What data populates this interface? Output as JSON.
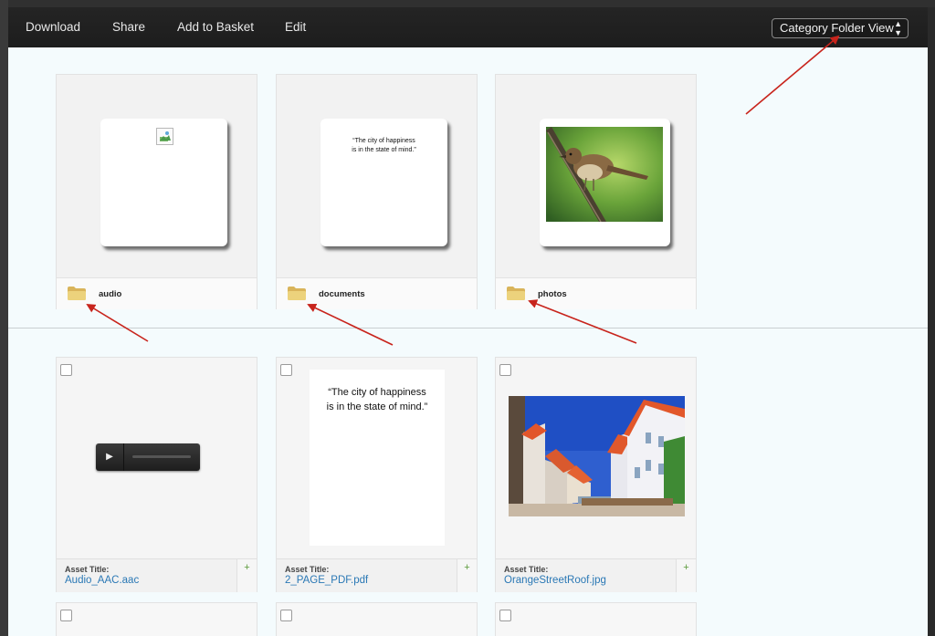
{
  "toolbar": {
    "download_label": "Download",
    "share_label": "Share",
    "add_to_basket_label": "Add to Basket",
    "edit_label": "Edit",
    "view_select_value": "Category Folder View"
  },
  "folders": [
    {
      "label": "audio"
    },
    {
      "label": "documents",
      "preview_quote_line1": "“The city of happiness",
      "preview_quote_line2": "is in the state of mind.”"
    },
    {
      "label": "photos"
    }
  ],
  "assets": [
    {
      "title_label": "Asset Title:",
      "filename": "Audio_AAC.aac",
      "add_label": "+"
    },
    {
      "title_label": "Asset Title:",
      "filename": "2_PAGE_PDF.pdf",
      "add_label": "+",
      "quote_line1": "“The city of happiness",
      "quote_line2": "is in the state of mind.”"
    },
    {
      "title_label": "Asset Title:",
      "filename": "OrangeStreetRoof.jpg",
      "add_label": "+"
    }
  ],
  "colors": {
    "toolbar_bg": "#1f1f1f",
    "content_bg": "#f4fbfd",
    "link": "#2a78b5",
    "annotation_arrow": "#c8241c",
    "plus": "#5a9a3a"
  }
}
